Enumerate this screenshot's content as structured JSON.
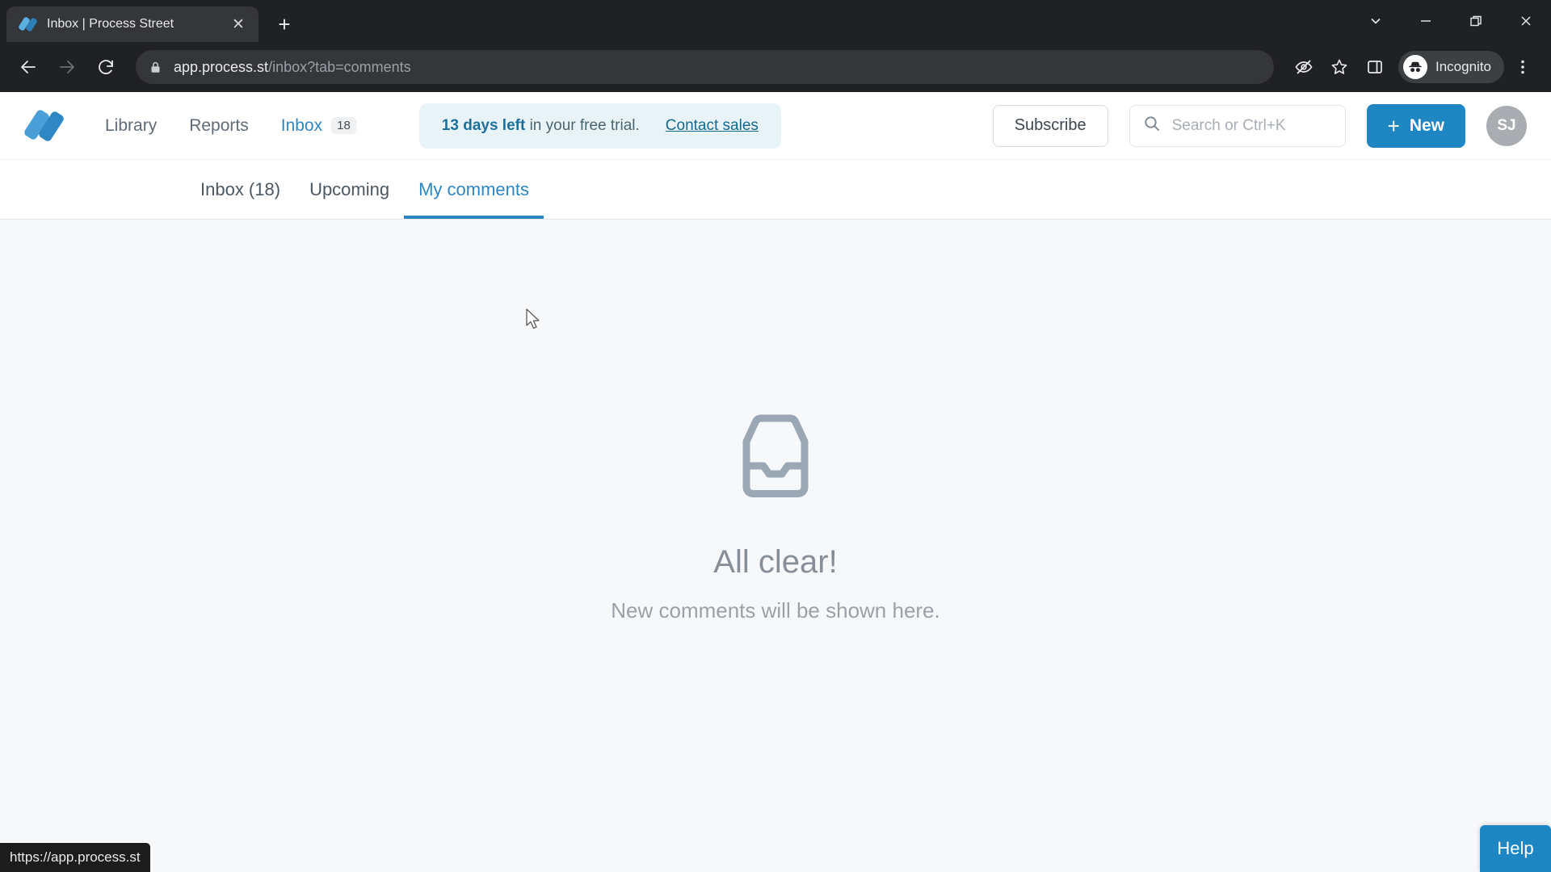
{
  "browser": {
    "tab": {
      "title": "Inbox | Process Street",
      "favicon_icon": "process-street-logo-icon",
      "close_icon": "close-icon"
    },
    "new_tab_icon": "plus-icon",
    "window_controls": [
      {
        "name": "tab-search",
        "icon": "chevron-down-icon"
      },
      {
        "name": "minimize",
        "icon": "minimize-icon"
      },
      {
        "name": "maximize",
        "icon": "restore-icon"
      },
      {
        "name": "close",
        "icon": "close-icon"
      }
    ],
    "back_icon": "arrow-left-icon",
    "forward_icon": "arrow-right-icon",
    "reload_icon": "reload-icon",
    "lock_icon": "lock-icon",
    "url_host": "app.process.st",
    "url_path": "/inbox?tab=comments",
    "toolbar_icons": [
      {
        "name": "tracking-protection",
        "icon": "eye-off-icon"
      },
      {
        "name": "bookmark",
        "icon": "star-icon"
      },
      {
        "name": "side-panel",
        "icon": "side-panel-icon"
      }
    ],
    "incognito_label": "Incognito",
    "incognito_icon": "incognito-hat-icon",
    "menu_icon": "three-dots-vertical-icon"
  },
  "app": {
    "logo_icon": "process-street-logo-icon",
    "nav": [
      {
        "label": "Library",
        "active": false
      },
      {
        "label": "Reports",
        "active": false
      },
      {
        "label": "Inbox",
        "active": true,
        "badge": "18"
      }
    ],
    "trial": {
      "highlight": "13 days left",
      "rest": " in your free trial.",
      "link": "Contact sales"
    },
    "subscribe_label": "Subscribe",
    "search": {
      "placeholder": "Search or Ctrl+K",
      "icon": "search-icon"
    },
    "new_button": {
      "label": "New",
      "plus": "+"
    },
    "avatar_initials": "SJ",
    "tabs": [
      {
        "label": "Inbox (18)",
        "active": false
      },
      {
        "label": "Upcoming",
        "active": false
      },
      {
        "label": "My comments",
        "active": true
      }
    ],
    "empty_state": {
      "icon": "inbox-tray-icon",
      "title": "All clear!",
      "subtitle": "New comments will be shown here."
    },
    "help_label": "Help"
  },
  "status_bar": {
    "url": "https://app.process.st"
  },
  "colors": {
    "brand_blue": "#1f86c4",
    "accent_blue": "#2e86c1",
    "banner_bg": "#e8f3f8",
    "page_bg": "#f7f8fa",
    "chrome_bg": "#202124"
  }
}
